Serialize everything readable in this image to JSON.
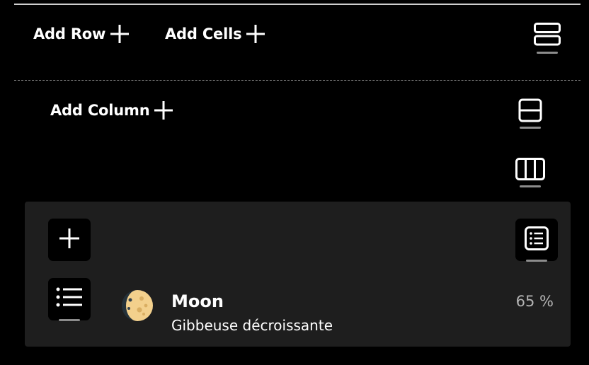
{
  "toolbar": {
    "add_row_label": "Add Row",
    "add_cells_label": "Add Cells",
    "add_column_label": "Add Column"
  },
  "icons": {
    "plus": "plus-icon",
    "rows_layout": "rows-layout-icon",
    "split_horizontal": "split-horizontal-icon",
    "columns_layout": "columns-layout-icon",
    "list_card": "list-card-icon",
    "bullet_list": "bullet-list-icon",
    "moon": "moon-waning-gibbous-icon"
  },
  "moon": {
    "name": "Moon",
    "phase": "Gibbeuse décroissante",
    "illumination": "65 %"
  },
  "colors": {
    "background": "#000000",
    "card": "#1e1e1e",
    "muted_text": "#b3b3b3",
    "moon_light": "#f3d08c",
    "moon_dark": "#24313a"
  }
}
